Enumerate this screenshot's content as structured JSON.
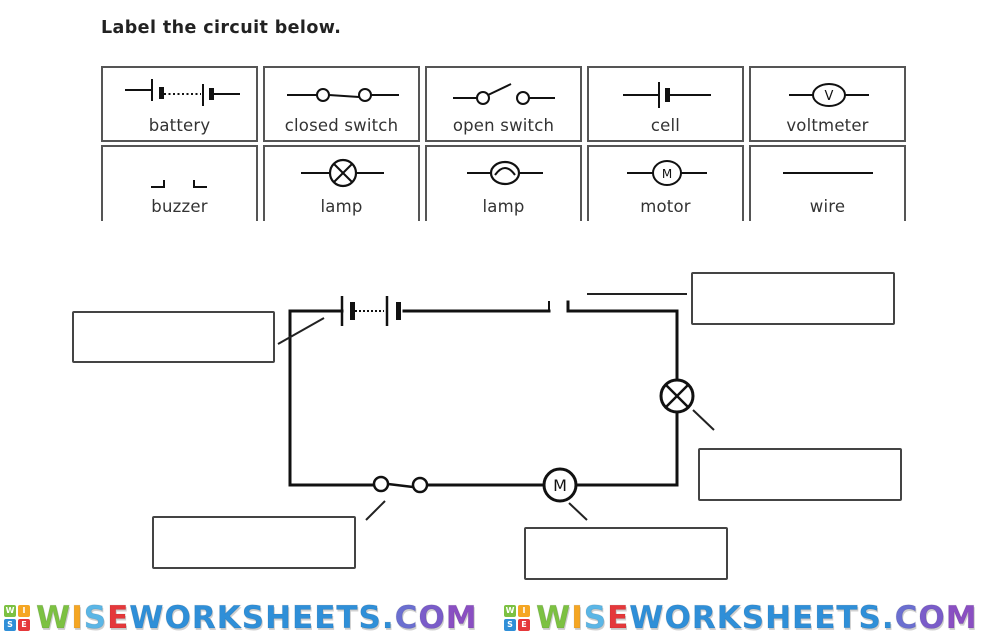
{
  "worksheet": {
    "title": "Label the circuit below."
  },
  "key": {
    "symbols": [
      {
        "name": "battery",
        "label": "battery"
      },
      {
        "name": "closed-switch",
        "label": "closed switch"
      },
      {
        "name": "open-switch",
        "label": "open switch"
      },
      {
        "name": "cell",
        "label": "cell"
      },
      {
        "name": "voltmeter",
        "label": "voltmeter",
        "glyph": "V"
      },
      {
        "name": "buzzer",
        "label": "buzzer"
      },
      {
        "name": "lamp",
        "label": "lamp"
      },
      {
        "name": "lamp-filament",
        "label": "lamp"
      },
      {
        "name": "motor",
        "label": "motor",
        "glyph": "M"
      },
      {
        "name": "wire",
        "label": "wire"
      }
    ]
  },
  "circuit": {
    "components": [
      "battery",
      "buzzer",
      "lamp",
      "motor",
      "closed switch"
    ],
    "motor_glyph": "M",
    "answer_boxes": [
      {
        "name": "battery-answer",
        "value": ""
      },
      {
        "name": "buzzer-answer",
        "value": ""
      },
      {
        "name": "lamp-answer",
        "value": ""
      },
      {
        "name": "switch-answer",
        "value": ""
      },
      {
        "name": "motor-answer",
        "value": ""
      }
    ]
  },
  "footer": {
    "watermark": "WISEWORKSHEETS.COM",
    "logo_letters": [
      "W",
      "I",
      "S",
      "E"
    ],
    "colors": {
      "green": "#7cc142",
      "orange": "#f5a623",
      "blue": "#2f8fd8",
      "red": "#e5383b",
      "purple": "#8a4fc2"
    }
  }
}
